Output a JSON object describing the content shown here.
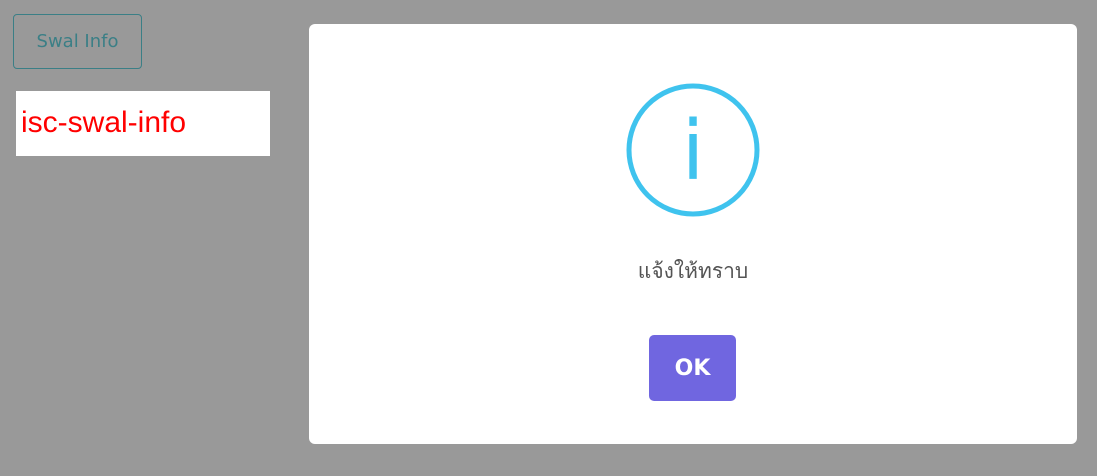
{
  "page": {
    "button_label": "Swal Info",
    "tag_text": "isc-swal-info"
  },
  "modal": {
    "icon": "info-circle-icon",
    "icon_glyph": "i",
    "icon_color": "#3fc3ee",
    "message": "แจ้งให้ทราบ",
    "confirm_label": "OK",
    "confirm_color": "#7066e0"
  },
  "colors": {
    "backdrop": "#999999",
    "tag_text": "#ff0000",
    "button_outline": "#3b7f86"
  }
}
